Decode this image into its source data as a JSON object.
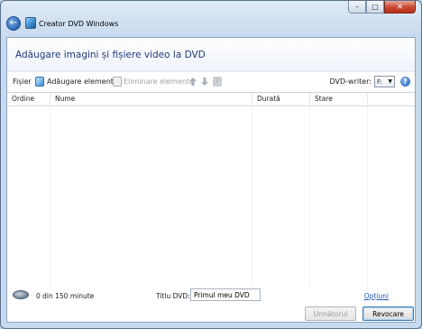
{
  "window": {
    "title": "Creator DVD Windows",
    "buttons": {
      "minimize": "–",
      "maximize": "□",
      "close": "×"
    }
  },
  "header": {
    "heading": "Adăugare imagini și fișiere video la DVD"
  },
  "toolbar": {
    "file_label": "Fișier",
    "add_label": "Adăugare elemente",
    "remove_label": "Eliminare elemente",
    "dvd_writer_label": "DVD-writer:",
    "dvd_writer_value": "F:",
    "help_glyph": "?"
  },
  "table": {
    "columns": [
      "Ordine",
      "Nume",
      "Durată",
      "Stare"
    ],
    "rows": []
  },
  "footer": {
    "capacity": "0 din 150 minute",
    "dvd_title_label": "Titlu DVD:",
    "dvd_title_value": "Primul meu DVD",
    "options_link": "Opțiuni"
  },
  "buttons": {
    "next_label": "Următorul",
    "cancel_label": "Revocare"
  },
  "colors": {
    "heading": "#1f3a7a",
    "link": "#1b56b3",
    "frame": "#c8daee"
  }
}
